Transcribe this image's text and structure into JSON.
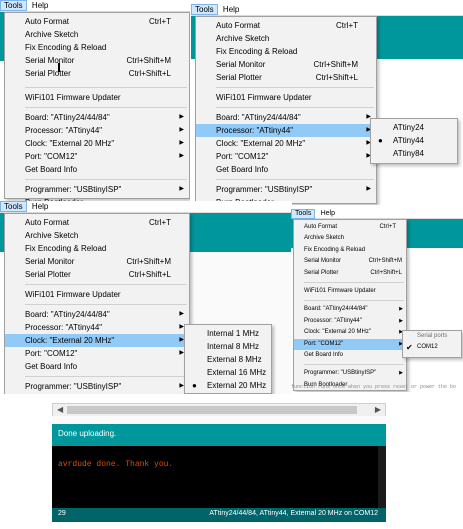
{
  "menubar": {
    "tools": "Tools",
    "help": "Help"
  },
  "tools_menu": {
    "auto_format": "Auto Format",
    "auto_format_sc": "Ctrl+T",
    "archive_sketch": "Archive Sketch",
    "fix_encoding": "Fix Encoding & Reload",
    "serial_monitor": "Serial Monitor",
    "serial_monitor_sc": "Ctrl+Shift+M",
    "serial_plotter": "Serial Plotter",
    "serial_plotter_sc": "Ctrl+Shift+L",
    "wifi_updater": "WiFi101 Firmware Updater",
    "board": "Board: \"ATtiny24/44/84\"",
    "processor": "Processor: \"ATtiny44\"",
    "clock": "Clock: \"External 20 MHz\"",
    "port": "Port: \"COM12\"",
    "get_board_info": "Get Board Info",
    "programmer": "Programmer: \"USBtinyISP\"",
    "burn_bootloader": "Burn Bootloader"
  },
  "processor_submenu": [
    "ATtiny24",
    "ATtiny44",
    "ATtiny84"
  ],
  "processor_selected": "ATtiny44",
  "clock_submenu": [
    "Internal 1 MHz",
    "Internal 8 MHz",
    "External 8 MHz",
    "External 16 MHz",
    "External 20 MHz"
  ],
  "clock_selected": "External 20 MHz",
  "port_submenu": {
    "header": "Serial ports",
    "items": [
      "COM12"
    ]
  },
  "port_selected": "COM12",
  "code_hint": "function runs once when you press reset or power the bo",
  "ide": {
    "status_message": "Done uploading.",
    "console_text": "avrdude done.  Thank you.",
    "line_number": "29",
    "board_summary": "ATtiny24/44/84, ATtiny44, External 20 MHz on COM12"
  },
  "colors": {
    "teal": "#00979c",
    "teal_dark": "#006468",
    "console_text": "#e34c00",
    "menu_highlight": "#91c9f7"
  }
}
